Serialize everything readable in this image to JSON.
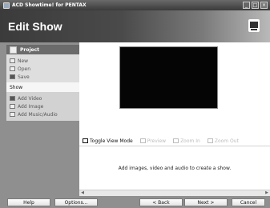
{
  "window": {
    "title": "ACD Showtime! for PENTAX",
    "minimize": "_",
    "maximize": "□",
    "close": "×"
  },
  "header": {
    "title": "Edit Show"
  },
  "project": {
    "heading": "Project",
    "items": [
      {
        "label": "New",
        "icon": "new-icon"
      },
      {
        "label": "Open",
        "icon": "open-icon"
      },
      {
        "label": "Save",
        "icon": "save-icon"
      }
    ]
  },
  "show": {
    "heading": "Show",
    "items": [
      {
        "label": "Add Video",
        "icon": "video-icon"
      },
      {
        "label": "Add Image",
        "icon": "image-icon"
      },
      {
        "label": "Add Music/Audio",
        "icon": "music-icon"
      }
    ]
  },
  "modes": [
    {
      "label": "Toggle View Mode",
      "enabled": true
    },
    {
      "label": "Preview",
      "enabled": false
    },
    {
      "label": "Zoom In",
      "enabled": false
    },
    {
      "label": "Zoom Out",
      "enabled": false
    }
  ],
  "content": {
    "message": "Add images, video and audio to create a show."
  },
  "buttons": {
    "help": "Help",
    "options": "Options...",
    "back": "< Back",
    "next": "Next >",
    "cancel": "Cancel"
  }
}
